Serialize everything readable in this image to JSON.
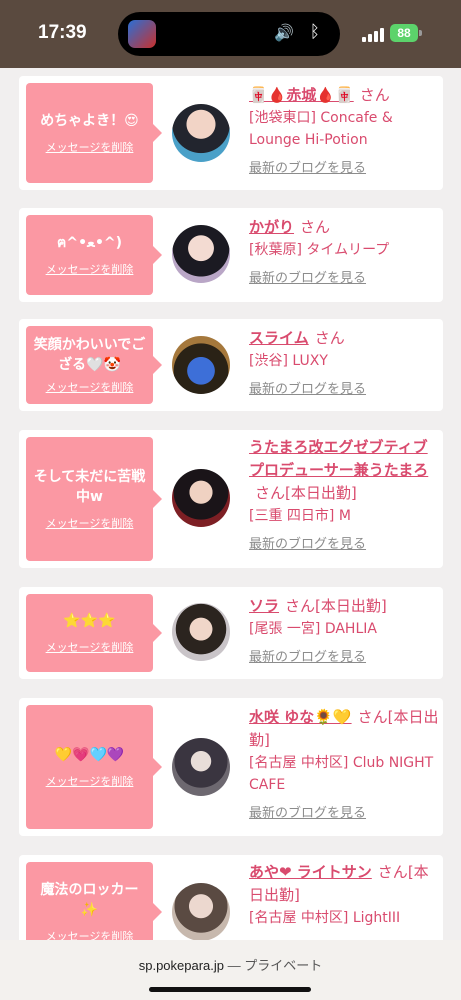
{
  "status": {
    "time": "17:39",
    "battery": "88"
  },
  "delete_label": "メッセージを削除",
  "blog_label": "最新のブログを見る",
  "san": "さん",
  "cards": [
    {
      "message": "めちゃよき！😍",
      "name": "🀄🩸赤城🩸🀄",
      "shop": "[池袋東口] Concafe & Lounge Hi-Potion"
    },
    {
      "message": "ฅ^•ﻌ•^)",
      "name": "かがり",
      "shop": "[秋葉原] タイムリープ"
    },
    {
      "message": "笑顔かわいいでござる🤍🤡",
      "name": "スライム",
      "shop": "[渋谷] LUXY"
    },
    {
      "message": "そして未だに苦戦中w",
      "name": "うたまろ改エグゼブティブプロデューサー兼うたまろ",
      "status": "[本日出勤]",
      "shop": "[三重 四日市] M"
    },
    {
      "message": "⭐⭐⭐",
      "name": "ソラ",
      "status": "[本日出勤]",
      "shop": "[尾張 一宮] DAHLIA"
    },
    {
      "message": "💛💗🩵💜",
      "name": "水咲 ゆな🌻💛",
      "status": "[本日出勤]",
      "shop": "[名古屋 中村区] Club NIGHT CAFE"
    },
    {
      "message": "魔法のロッカー✨",
      "name": "あや❤︎ ライトサン",
      "status": "[本日出勤]",
      "shop": "[名古屋 中村区] LightIII"
    }
  ],
  "browser": {
    "url": "sp.pokepara.jp",
    "mode": "— プライベート"
  }
}
